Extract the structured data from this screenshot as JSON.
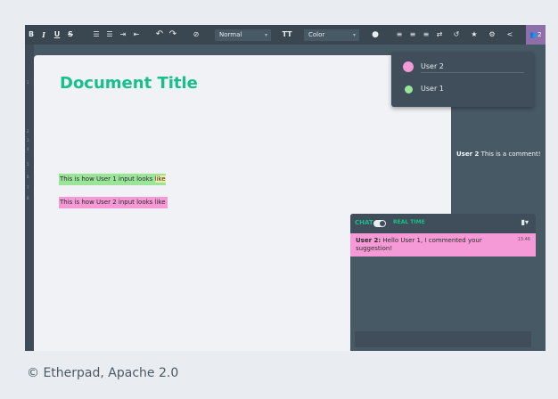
{
  "toolbar": {
    "bold": "B",
    "italic": "I",
    "underline": "U",
    "strike": "S",
    "font_size": "Normal",
    "text_size": "TT",
    "color": "Color",
    "users_count": "2"
  },
  "gutter": {
    "line_numbers": [
      "1",
      "2",
      "3",
      "4",
      "5",
      "6",
      "7",
      "8"
    ]
  },
  "document": {
    "title": "Document Title",
    "line1_main": "This is how User 1 input looks ",
    "line1_tail": "like",
    "line2": "This is how User 2 input looks like"
  },
  "side_comment": {
    "author": "User 2",
    "text": " This is a comment!"
  },
  "users_popup": {
    "users": [
      {
        "name": "User 2",
        "color": "#f49ad6"
      },
      {
        "name": "User 1",
        "color": "#9be59a"
      }
    ]
  },
  "chat": {
    "title": "CHAT",
    "realtime_label": "REAL TIME",
    "message": {
      "author": "User 2:",
      "text": " Hello User 1, I commented your suggestion!",
      "time": "13:46"
    }
  },
  "caption": "© Etherpad, Apache 2.0",
  "colors": {
    "accent": "#17c08a",
    "user1": "#9be59a",
    "user2": "#f59ad6",
    "panel": "#485966"
  }
}
